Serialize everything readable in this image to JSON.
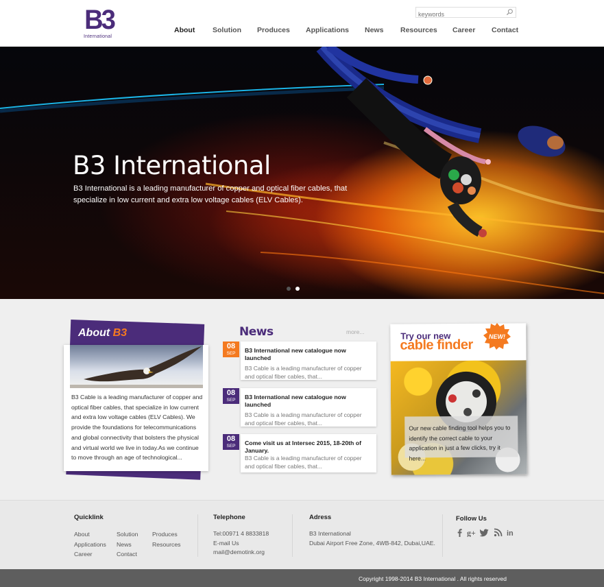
{
  "header": {
    "logo": {
      "mark": "B3",
      "sub": "International"
    },
    "search": {
      "placeholder": "keywords"
    },
    "nav": [
      {
        "label": "About",
        "active": true
      },
      {
        "label": "Solution"
      },
      {
        "label": "Produces"
      },
      {
        "label": "Applications"
      },
      {
        "label": "News"
      },
      {
        "label": "Resources"
      },
      {
        "label": "Career"
      },
      {
        "label": "Contact"
      }
    ]
  },
  "hero": {
    "title": "B3 International",
    "text": "B3 International is a leading manufacturer of copper and optical fiber cables, that specialize in low current and extra low voltage cables (ELV Cables).",
    "slides": 2,
    "active_slide": 2
  },
  "about": {
    "title_prefix": "About ",
    "title_highlight": "B3",
    "text": "B3 Cable is a leading manufacturer of copper and optical fiber cables, that specialize in low current and extra low voltage cables (ELV Cables). We provide the foundations for telecommunications and global connectivity that bolsters the physical and virtual world we live in today.As we continue to move through an age of technological..."
  },
  "news": {
    "title": "News",
    "more": "more...",
    "items": [
      {
        "day": "08",
        "month": "SEP",
        "headline": "B3 International new catalogue now  launched",
        "body": "B3 Cable is a leading manufacturer of  copper and optical fiber cables, that...",
        "color": "orange"
      },
      {
        "day": "08",
        "month": "SEP",
        "headline": "B3 International new catalogue now launched",
        "body": "B3 Cable is a leading manufacturer of copper and optical fiber cables, that...",
        "color": "purple"
      },
      {
        "day": "08",
        "month": "SEP",
        "headline": "Come visit us at Intersec 2015, 18-20th of January.",
        "body": "B3 Cable is a leading manufacturer of copper and optical fiber cables, that...",
        "color": "purple"
      }
    ]
  },
  "cable_finder": {
    "line1": "Try our new",
    "line2": "cable finder",
    "badge": "NEW!",
    "text": "Our new cable finding tool helps you to identify the correct cable to your application in just a few clicks, try it here..."
  },
  "footer": {
    "quicklink": {
      "title": "Quicklink",
      "links": [
        "About",
        "Solution",
        "Produces",
        "Applications",
        "News",
        "Resources",
        "Career",
        "Contact"
      ]
    },
    "telephone": {
      "title": "Telephone",
      "tel": "Tel:00971 4 8833818",
      "email_label": "E-mail Us",
      "email": "mail@demotink.org"
    },
    "address": {
      "title": "Adress",
      "line1": "B3 International",
      "line2": "Dubai Airport Free Zone, 4WB-842, Dubai,UAE."
    },
    "follow": {
      "title": "Follow Us",
      "icons": [
        "facebook-icon",
        "google-plus-icon",
        "twitter-icon",
        "rss-icon",
        "linkedin-icon"
      ]
    },
    "copyright": "Copyright 1998-2014  B3 International . All rights reserved"
  },
  "colors": {
    "brand_purple": "#4b2c7a",
    "accent_orange": "#f47a20",
    "footer_bar": "#5e5e5e"
  }
}
